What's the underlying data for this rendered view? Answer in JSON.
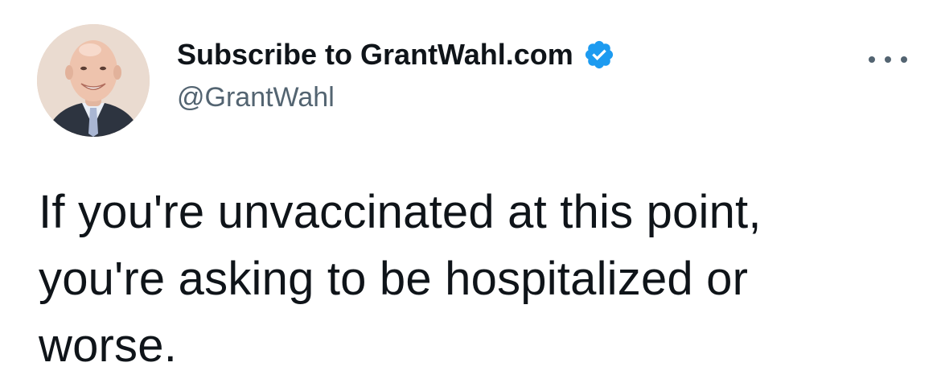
{
  "tweet": {
    "author": {
      "display_name": "Subscribe to GrantWahl.com",
      "handle": "@GrantWahl",
      "verified": true,
      "avatar_icon": "profile-photo"
    },
    "menu_icon": "more-horizontal-icon",
    "text_lines": [
      "If you're unvaccinated at this point,",
      "you're asking to be hospitalized or",
      "worse."
    ]
  },
  "colors": {
    "text_primary": "#0f1419",
    "text_secondary": "#536471",
    "verified_blue": "#1d9bf0",
    "background": "#ffffff"
  }
}
